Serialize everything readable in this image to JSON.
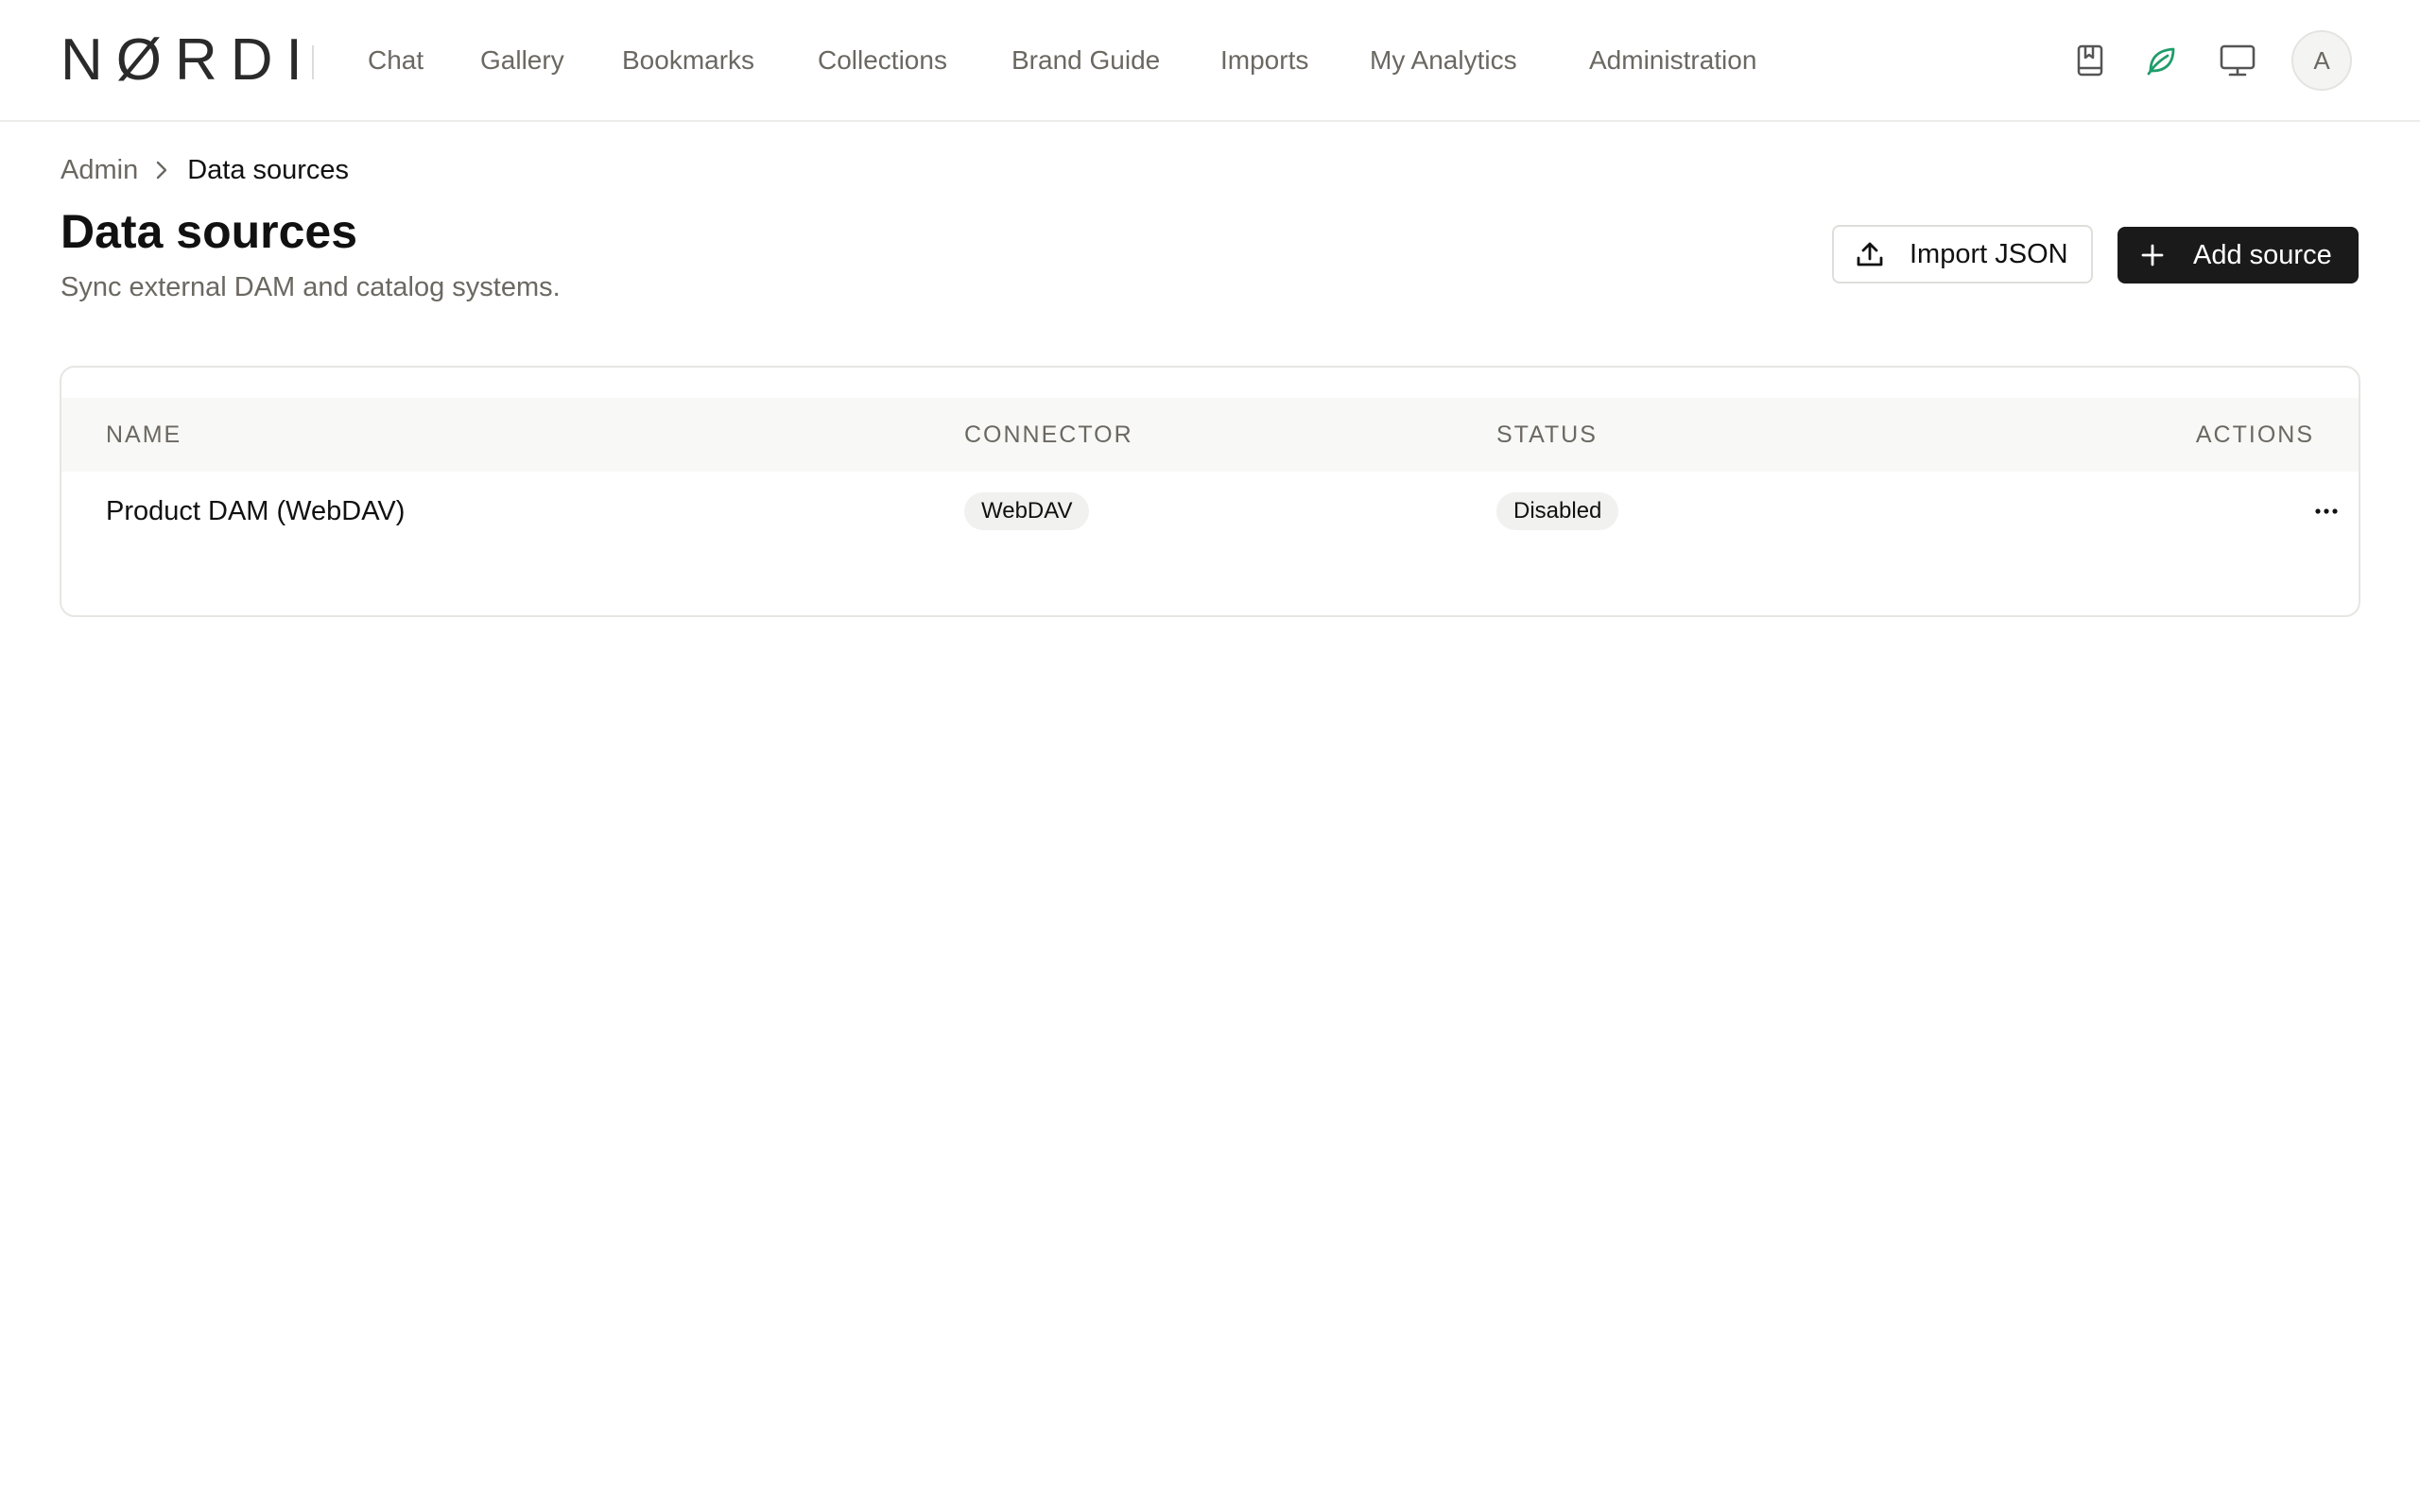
{
  "app": {
    "logo_text": "NØRDI"
  },
  "nav": {
    "items": [
      {
        "label": "Chat"
      },
      {
        "label": "Gallery"
      },
      {
        "label": "Bookmarks"
      },
      {
        "label": "Collections"
      },
      {
        "label": "Brand Guide"
      },
      {
        "label": "Imports"
      },
      {
        "label": "My Analytics"
      },
      {
        "label": "Administration"
      }
    ],
    "right_icons": [
      "bookmark-icon",
      "leaf-icon",
      "monitor-icon"
    ],
    "avatar_initial": "A"
  },
  "breadcrumb": {
    "parent": "Admin",
    "current": "Data sources"
  },
  "page": {
    "title": "Data sources",
    "subtitle": "Sync external DAM and catalog systems."
  },
  "actions": {
    "import_label": "Import JSON",
    "add_label": "Add source"
  },
  "table": {
    "columns": {
      "name": "NAME",
      "connector": "CONNECTOR",
      "status": "STATUS",
      "actions": "ACTIONS"
    },
    "rows": [
      {
        "name": "Product DAM (WebDAV)",
        "connector": "WebDAV",
        "status": "Disabled"
      }
    ]
  },
  "colors": {
    "accent_green": "#1f9d6a",
    "primary_button": "#1a1a1a",
    "muted_text": "#6b6862"
  }
}
